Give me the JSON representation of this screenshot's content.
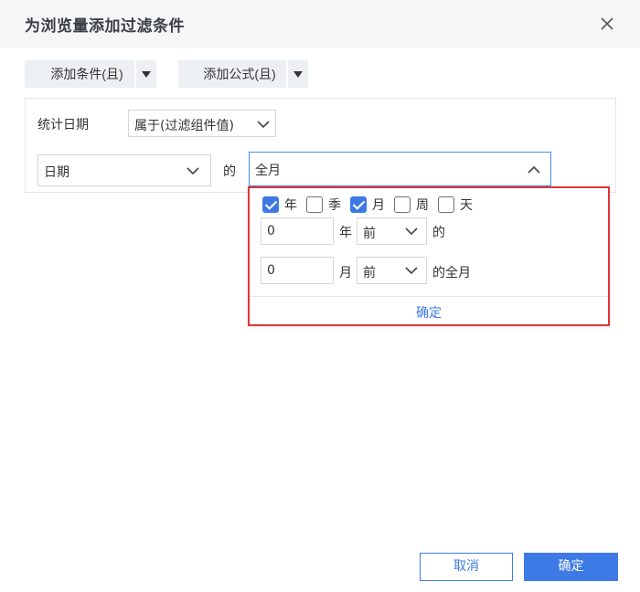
{
  "dialog": {
    "title": "为浏览量添加过滤条件"
  },
  "toolbar": {
    "add_condition_label": "添加条件(且)",
    "add_formula_label": "添加公式(且)"
  },
  "condition": {
    "field_label": "统计日期",
    "operator_value": "属于(过滤组件值)",
    "date_field_value": "日期",
    "of_label": "的",
    "range_value": "全月"
  },
  "popup": {
    "checkboxes": [
      {
        "label": "年",
        "checked": true
      },
      {
        "label": "季",
        "checked": false
      },
      {
        "label": "月",
        "checked": true
      },
      {
        "label": "周",
        "checked": false
      },
      {
        "label": "天",
        "checked": false
      }
    ],
    "year_offset_value": "0",
    "year_unit_label": "年",
    "year_direction_value": "前",
    "year_suffix_label": "的",
    "month_offset_value": "0",
    "month_unit_label": "月",
    "month_direction_value": "前",
    "month_suffix_label": "的全月",
    "confirm_label": "确定"
  },
  "footer": {
    "cancel_label": "取消",
    "ok_label": "确定"
  },
  "colors": {
    "accent": "#3e7ae6",
    "highlight_border": "#e0353b"
  },
  "icons": {
    "close": "close-icon",
    "dropdown_arrow": "caret-down-icon",
    "chevron_down": "chevron-down-icon",
    "chevron_up": "chevron-up-icon"
  }
}
